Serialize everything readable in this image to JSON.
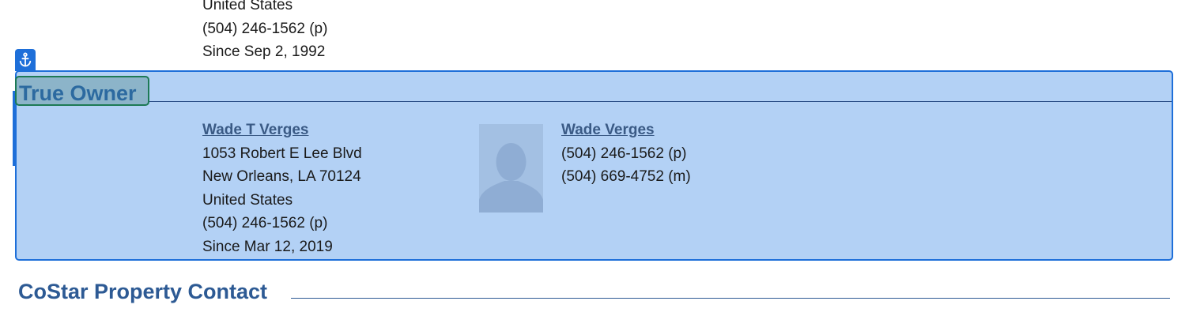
{
  "previous_contact": {
    "country": "United States",
    "phone": "(504) 246-1562 (p)",
    "since": "Since Sep 2, 1992"
  },
  "true_owner": {
    "section_title": "True Owner",
    "owner": {
      "name": "Wade T Verges",
      "address_line1": "1053 Robert E Lee Blvd",
      "address_line2": "New Orleans, LA 70124",
      "country": "United States",
      "phone": "(504) 246-1562 (p)",
      "since": "Since Mar 12, 2019"
    },
    "contact": {
      "name": "Wade Verges",
      "phone_p": "(504) 246-1562 (p)",
      "phone_m": "(504) 669-4752 (m)",
      "avatar_icon": "person-silhouette-icon"
    }
  },
  "next_section": {
    "title": "CoStar Property Contact"
  },
  "icons": {
    "anchor": "anchor-icon"
  },
  "colors": {
    "highlight_bg": "#b3d1f5",
    "highlight_border": "#1e6fd9",
    "heading_blue": "#2d5a94",
    "title_box_border": "#1d7a55"
  }
}
